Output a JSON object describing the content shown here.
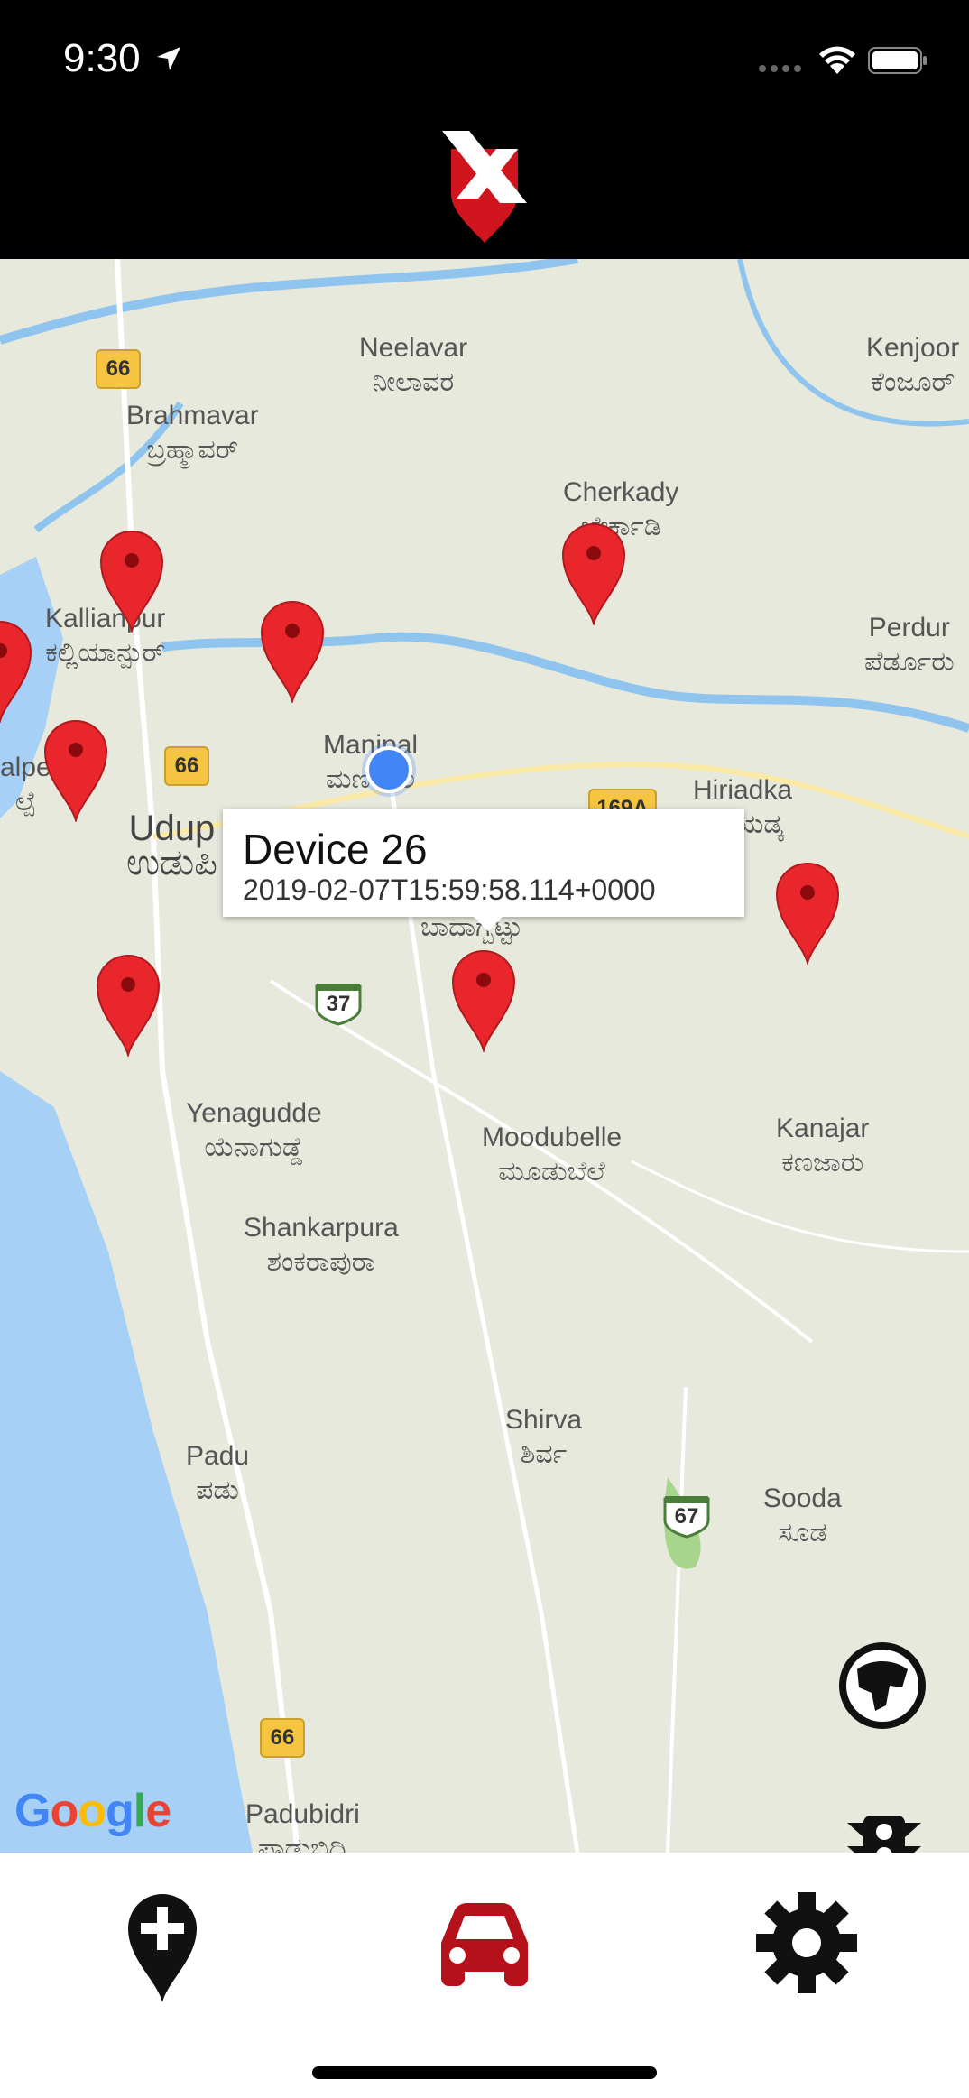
{
  "status_bar": {
    "time": "9:30",
    "icons": [
      "location-arrow-icon",
      "signal-icon",
      "wifi-icon",
      "battery-icon"
    ]
  },
  "header": {
    "logo": "app-logo",
    "accent": "#d0151f"
  },
  "map": {
    "places": [
      {
        "id": "neelavar",
        "en": "Neelavar",
        "kn": "ನೀಲಾವರ"
      },
      {
        "id": "kenjoor",
        "en": "Kenjoor",
        "kn": "ಕೆಂಜೂರ್"
      },
      {
        "id": "brahmavar",
        "en": "Brahmavar",
        "kn": "ಬ್ರಹ್ಮಾವರ್"
      },
      {
        "id": "cherkady",
        "en": "Cherkady",
        "kn": "ಚೇರ್ಕಾಡಿ"
      },
      {
        "id": "kallianpur",
        "en": "Kallianpur",
        "kn": "ಕಲ್ಲಿಯಾನ್ಪುರ್"
      },
      {
        "id": "perdur",
        "en": "Perdur",
        "kn": "ಪೆರ್ಡೂರು"
      },
      {
        "id": "manipal",
        "en": "Manipal",
        "kn": "ಮಣಿಪಾಲ"
      },
      {
        "id": "hiriadka",
        "en": "Hiriadka",
        "kn": "ಹಿರಿಯಡ್ಕ"
      },
      {
        "id": "malpe",
        "en": "alpe",
        "kn": "ಲ್ಪೆ"
      },
      {
        "id": "udupi",
        "en": "Udup",
        "kn": "ಉಡುಪಿ"
      },
      {
        "id": "badagabettu",
        "en": "",
        "kn": "ಬಾದಾಗ್ಬೆಟ್ಟು"
      },
      {
        "id": "yenagudde",
        "en": "Yenagudde",
        "kn": "ಯೆನಾಗುಡ್ಡೆ"
      },
      {
        "id": "moodubelle",
        "en": "Moodubelle",
        "kn": "ಮೂಡುಬೆಲೆ"
      },
      {
        "id": "kanajar",
        "en": "Kanajar",
        "kn": "ಕಣಜಾರು"
      },
      {
        "id": "shankarpura",
        "en": "Shankarpura",
        "kn": "ಶಂಕರಾಪುರಾ"
      },
      {
        "id": "shirva",
        "en": "Shirva",
        "kn": "ಶಿರ್ವ"
      },
      {
        "id": "padu",
        "en": "Padu",
        "kn": "ಪಡು"
      },
      {
        "id": "sooda",
        "en": "Sooda",
        "kn": "ಸೂಡ"
      },
      {
        "id": "padubidri",
        "en": "Padubidri",
        "kn": "ಪಾಡುಬಿದ್ರಿ"
      }
    ],
    "road_shields": [
      "66",
      "66",
      "169A",
      "37",
      "67",
      "66"
    ],
    "marker_color": "#e8262c",
    "callout": {
      "title": "Device 26",
      "subtitle": "2019-02-07T15:59:58.114+0000"
    },
    "attribution": "Google",
    "controls": [
      "map-type-icon",
      "traffic-light-icon",
      "recenter-icon"
    ]
  },
  "tabs": [
    {
      "name": "add-location",
      "icon": "add-location-icon",
      "active": false
    },
    {
      "name": "devices",
      "icon": "car-icon",
      "active": true
    },
    {
      "name": "settings",
      "icon": "gear-icon",
      "active": false
    }
  ]
}
